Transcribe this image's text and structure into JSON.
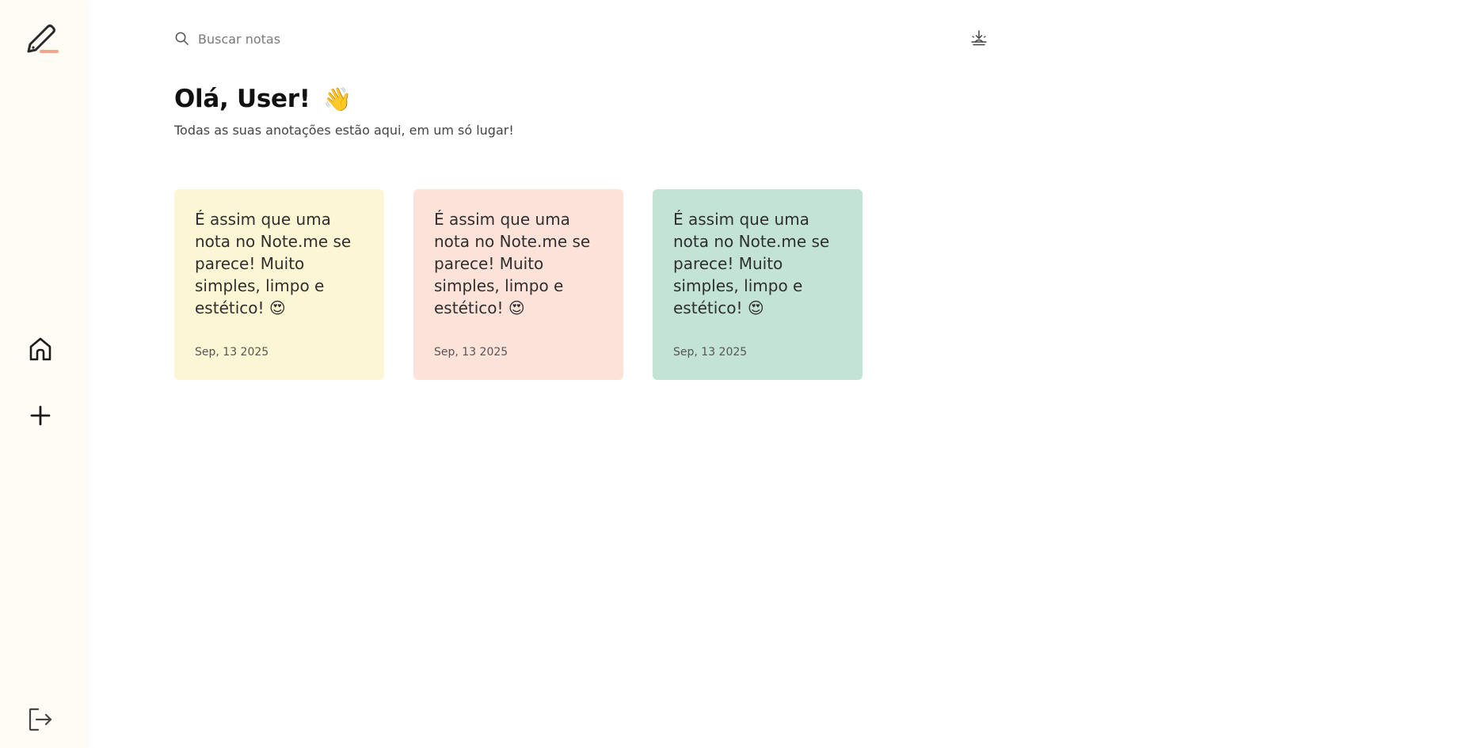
{
  "search": {
    "placeholder": "Buscar notas"
  },
  "greeting": {
    "prefix": "Olá,",
    "name": "User!",
    "emoji": "👋"
  },
  "subtitle": "Todas as suas anotações estão aqui, em um só lugar!",
  "notes": [
    {
      "text": "É assim que uma nota no Note.me se parece! Muito simples, limpo e estético! 😍",
      "date": "Sep, 13 2025",
      "color": "#fdf6d4"
    },
    {
      "text": "É assim que uma nota no Note.me se parece! Muito simples, limpo e estético! 😍",
      "date": "Sep, 13 2025",
      "color": "#fde2da"
    },
    {
      "text": "É assim que uma nota no Note.me se parece! Muito simples, limpo e estético! 😍",
      "date": "Sep, 13 2025",
      "color": "#c2e3d6"
    }
  ],
  "icons": {
    "logo": "pencil-logo-icon",
    "search": "search-icon",
    "theme": "sunset-theme-icon",
    "home": "home-icon",
    "add": "plus-icon",
    "logout": "logout-icon"
  },
  "colors": {
    "sidebar": "#fffcf6",
    "accent": "#f5a48a"
  }
}
